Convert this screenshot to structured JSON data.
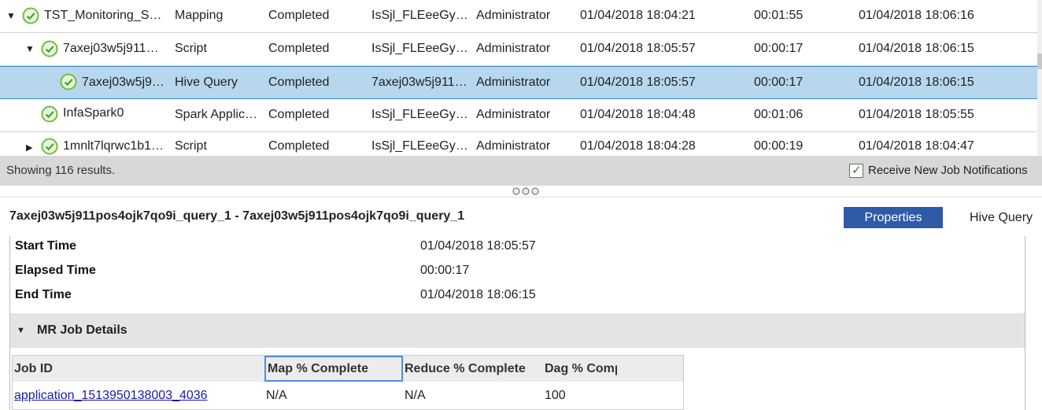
{
  "jobs": [
    {
      "name": "TST_Monitoring_S…",
      "type": "Mapping",
      "status": "Completed",
      "parent": "IsSjl_FLEeeGy…",
      "user": "Administrator",
      "start": "01/04/2018 18:04:21",
      "elapsed": "00:01:55",
      "end": "01/04/2018 18:06:16",
      "toggle": "▼"
    },
    {
      "name": "7axej03w5j911…",
      "type": "Script",
      "status": "Completed",
      "parent": "IsSjl_FLEeeGy…",
      "user": "Administrator",
      "start": "01/04/2018 18:05:57",
      "elapsed": "00:00:17",
      "end": "01/04/2018 18:06:15",
      "toggle": "▼"
    },
    {
      "name": "7axej03w5j9…",
      "type": "Hive Query",
      "status": "Completed",
      "parent": "7axej03w5j911…",
      "user": "Administrator",
      "start": "01/04/2018 18:05:57",
      "elapsed": "00:00:17",
      "end": "01/04/2018 18:06:15",
      "toggle": ""
    },
    {
      "name": "InfaSpark0",
      "type": "Spark Applic…",
      "status": "Completed",
      "parent": "IsSjl_FLEeeGy…",
      "user": "Administrator",
      "start": "01/04/2018 18:04:48",
      "elapsed": "00:01:06",
      "end": "01/04/2018 18:05:55",
      "toggle": ""
    },
    {
      "name": "1mnlt7lqrwc1b1…",
      "type": "Script",
      "status": "Completed",
      "parent": "IsSjl_FLEeeGy…",
      "user": "Administrator",
      "start": "01/04/2018 18:04:28",
      "elapsed": "00:00:19",
      "end": "01/04/2018 18:04:47",
      "toggle": "▶"
    }
  ],
  "status_bar": {
    "results": "Showing 116 results.",
    "notify_label": "Receive New Job Notifications",
    "notify_checked": "✓"
  },
  "detail": {
    "title": "7axej03w5j911pos4ojk7qo9i_query_1 - 7axej03w5j911pos4ojk7qo9i_query_1",
    "properties_button": "Properties",
    "tab_label": "Hive Query",
    "properties": [
      {
        "label": "Start Time",
        "value": "01/04/2018 18:05:57"
      },
      {
        "label": "Elapsed Time",
        "value": "00:00:17"
      },
      {
        "label": "End Time",
        "value": "01/04/2018 18:06:15"
      }
    ],
    "section": {
      "toggle": "▼",
      "label": "MR Job Details"
    },
    "mr_table": {
      "headers": [
        "Job ID",
        "Map % Complete",
        "Reduce % Complete",
        "Dag % Comp"
      ],
      "rows": [
        [
          "application_1513950138003_4036",
          "N/A",
          "N/A",
          "100"
        ]
      ]
    }
  },
  "colors": {
    "selected_row": "#b6d7ee",
    "status_ok": "#6bbf3a",
    "button": "#2e5aa8"
  }
}
